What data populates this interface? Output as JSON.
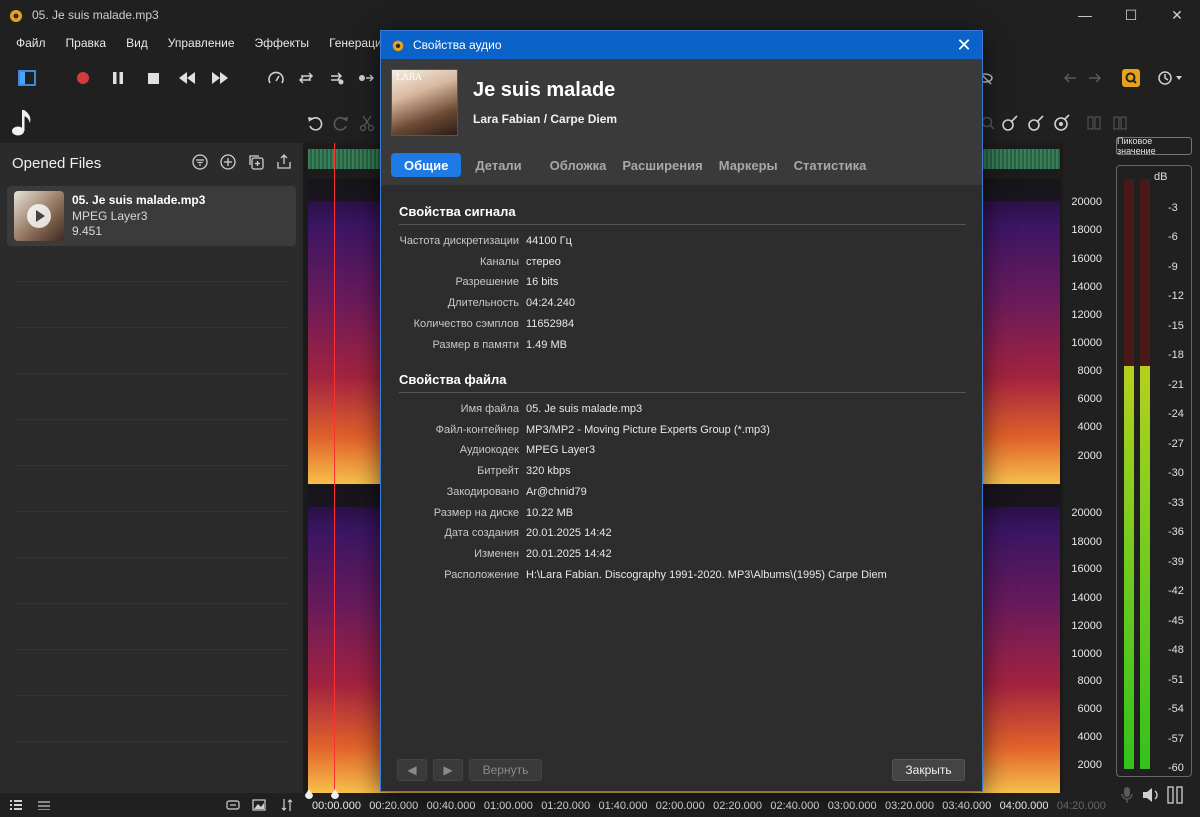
{
  "window": {
    "title": "05. Je suis malade.mp3",
    "minimize": "—",
    "maximize": "☐",
    "close": "✕"
  },
  "menu": [
    "Файл",
    "Правка",
    "Вид",
    "Управление",
    "Эффекты",
    "Генерация"
  ],
  "left_panel": {
    "title": "Opened Files",
    "file": {
      "name": "05. Je suis malade.mp3",
      "codec": "MPEG Layer3",
      "duration": "9.451"
    }
  },
  "meter": {
    "peak_label": "Пиковое значение",
    "unit": "dB",
    "db_ticks": [
      "-3",
      "-6",
      "-9",
      "-12",
      "-15",
      "-18",
      "-21",
      "-24",
      "-27",
      "-30",
      "-33",
      "-36",
      "-39",
      "-42",
      "-45",
      "-48",
      "-51",
      "-54",
      "-57",
      "-60"
    ],
    "left_level_db": -19,
    "right_level_db": -19
  },
  "freq_axis": {
    "top": [
      "20000",
      "18000",
      "16000",
      "14000",
      "12000",
      "10000",
      "8000",
      "6000",
      "4000",
      "2000"
    ],
    "bottom": [
      "20000",
      "18000",
      "16000",
      "14000",
      "12000",
      "10000",
      "8000",
      "6000",
      "4000",
      "2000"
    ]
  },
  "timeline": [
    "00:00.000",
    "00:20.000",
    "00:40.000",
    "01:00.000",
    "01:20.000",
    "01:40.000",
    "02:00.000",
    "02:20.000",
    "02:40.000",
    "03:00.000",
    "03:20.000",
    "03:40.000",
    "04:00.000",
    "04:20.000"
  ],
  "dialog": {
    "title": "Свойства аудио",
    "close": "✕",
    "cover_text": "LARA",
    "song_title": "Je suis malade",
    "song_subtitle": "Lara Fabian / Carpe Diem",
    "tabs": [
      "Общие",
      "Детали",
      "Обложка",
      "Расширения",
      "Маркеры",
      "Статистика"
    ],
    "active_tab": "Общие",
    "signal_section": "Свойства сигнала",
    "signal": [
      {
        "label": "Частота дискретизации",
        "value": "44100 Гц"
      },
      {
        "label": "Каналы",
        "value": "стерео"
      },
      {
        "label": "Разрешение",
        "value": "16 bits"
      },
      {
        "label": "Длительность",
        "value": "04:24.240"
      },
      {
        "label": "Количество сэмплов",
        "value": "11652984"
      },
      {
        "label": "Размер в памяти",
        "value": "1.49 MB"
      }
    ],
    "file_section": "Свойства файла",
    "file": [
      {
        "label": "Имя файла",
        "value": "05. Je suis malade.mp3"
      },
      {
        "label": "Файл-контейнер",
        "value": "MP3/MP2 - Moving Picture Experts Group (*.mp3)"
      },
      {
        "label": "Аудиокодек",
        "value": "MPEG Layer3"
      },
      {
        "label": "Битрейт",
        "value": "320 kbps"
      },
      {
        "label": "Закодировано",
        "value": "Ar@chnid79"
      },
      {
        "label": "Размер на диске",
        "value": "10.22 MB"
      },
      {
        "label": "Дата создания",
        "value": "20.01.2025 14:42"
      },
      {
        "label": "Изменен",
        "value": "20.01.2025 14:42"
      },
      {
        "label": "Расположение",
        "value": "H:\\Lara Fabian. Discography 1991-2020. MP3\\Albums\\(1995) Carpe Diem"
      }
    ],
    "footer": {
      "prev": "◀",
      "next": "▶",
      "revert": "Вернуть",
      "close": "Закрыть"
    }
  }
}
